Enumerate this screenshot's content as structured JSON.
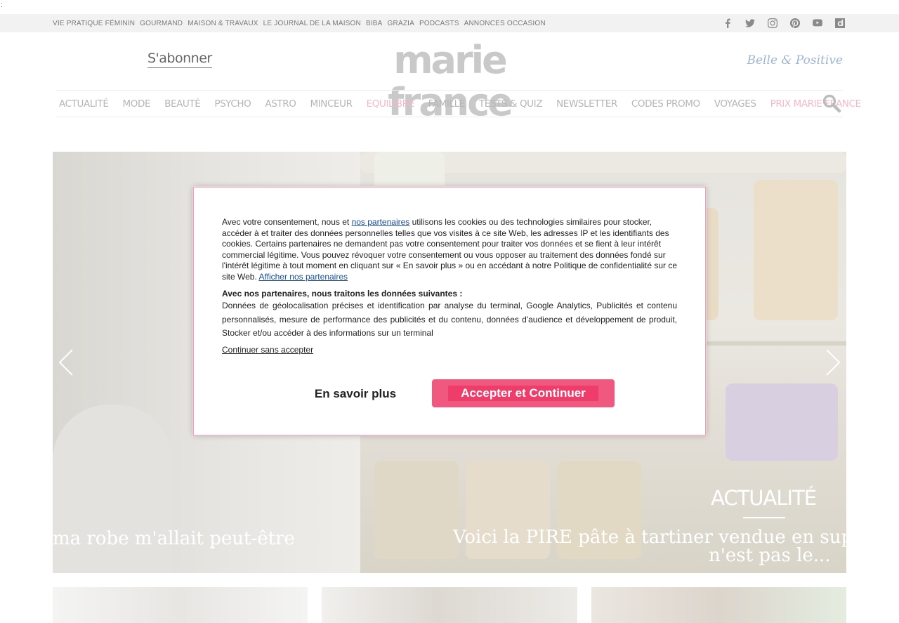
{
  "topbar": {
    "links": [
      "VIE PRATIQUE FÉMININ",
      "GOURMAND",
      "MAISON & TRAVAUX",
      "LE JOURNAL DE LA MAISON",
      "BIBA",
      "GRAZIA",
      "PODCASTS",
      "ANNONCES OCCASION"
    ],
    "socials": [
      "facebook-icon",
      "twitter-icon",
      "instagram-icon",
      "pinterest-icon",
      "youtube-icon",
      "dailymotion-icon"
    ]
  },
  "header": {
    "subscribe": "S'abonner",
    "logo": "marie france",
    "partner_logo": "Belle & Positive"
  },
  "nav": {
    "items": [
      {
        "label": "ACTUALITÉ",
        "highlight": false
      },
      {
        "label": "MODE",
        "highlight": false
      },
      {
        "label": "BEAUTÉ",
        "highlight": false
      },
      {
        "label": "PSYCHO",
        "highlight": false
      },
      {
        "label": "ASTRO",
        "highlight": false
      },
      {
        "label": "MINCEUR",
        "highlight": false
      },
      {
        "label": "EQUILIBRE",
        "highlight": true
      },
      {
        "label": "FAMILLE",
        "highlight": false
      },
      {
        "label": "TESTS & QUIZ",
        "highlight": false
      },
      {
        "label": "NEWSLETTER",
        "highlight": false
      },
      {
        "label": "CODES PROMO",
        "highlight": false
      },
      {
        "label": "VOYAGES",
        "highlight": false
      },
      {
        "label": "PRIX MARIE FRANCE",
        "highlight": true
      }
    ],
    "accent": "#f3b8cb"
  },
  "hero": {
    "left_caption": "ma robe m'allait peut-être",
    "category": "ACTUALITÉ",
    "right_caption_line1": "Voici la PIRE pâte à tartiner vendue en supermarché",
    "right_caption_line2": "n'est pas le..."
  },
  "consent": {
    "text_before_link": "Avec votre consentement, nous et ",
    "partners_link": "nos partenaires",
    "text_after_link": " utilisons les cookies ou des technologies similaires pour stocker, accéder à et traiter des données personnelles telles que vos visites à ce site Web, les adresses IP et les identifiants des cookies. Certains partenaires ne demandent pas votre consentement pour traiter vos données et se fient à leur intérêt commercial légitime. Vous pouvez révoquer votre consentement ou vous opposer au traitement des données fondé sur l'intérêt légitime à tout moment en cliquant sur « En savoir plus » ou en accédant à notre Politique de confidentialité sur ce site Web. ",
    "show_partners_link": "Afficher nos partenaires",
    "partners_title": "Avec nos partenaires, nous traitons les données suivantes :",
    "purposes": "Données de géolocalisation précises et identification par analyse du terminal, Google Analytics, Publicités et contenu personnalisés, mesure de performance des publicités et du contenu, données d'audience et développement de produit, Stocker et/ou accéder à des informations sur un terminal",
    "continue_without": "Continuer sans accepter",
    "more_button": "En savoir plus",
    "accept_button": "Accepter et Continuer",
    "accent": "#ee3d6a"
  }
}
